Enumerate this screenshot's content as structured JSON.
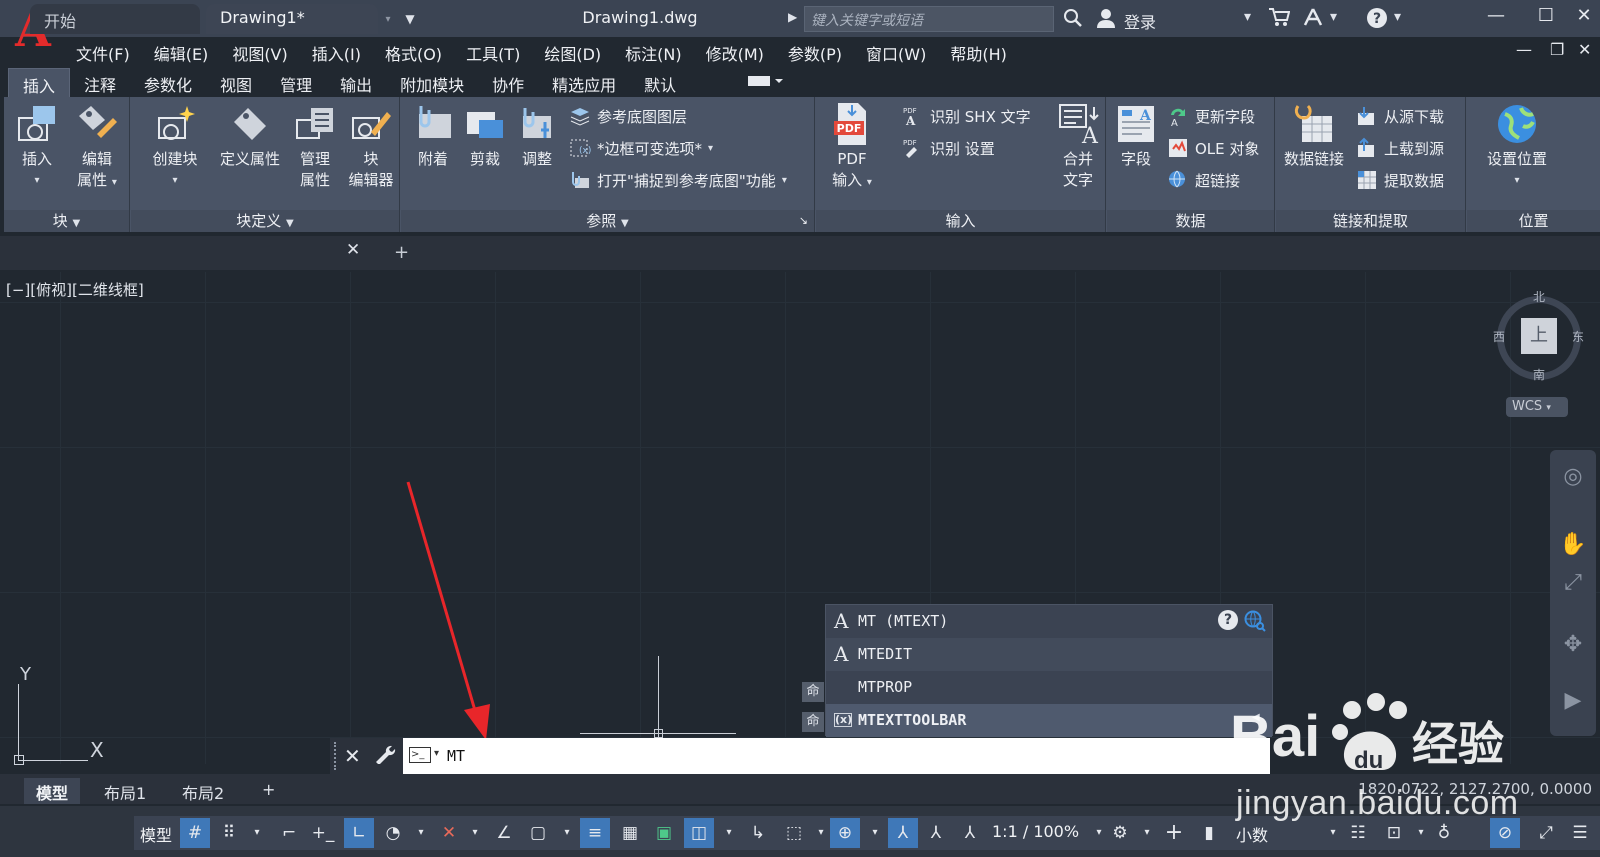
{
  "app": {
    "document_title": "Drawing1.dwg",
    "search_placeholder": "键入关键字或短语",
    "login_label": "登录"
  },
  "menu": [
    "文件(F)",
    "编辑(E)",
    "视图(V)",
    "插入(I)",
    "格式(O)",
    "工具(T)",
    "绘图(D)",
    "标注(N)",
    "修改(M)",
    "参数(P)",
    "窗口(W)",
    "帮助(H)"
  ],
  "ribbon_tabs": [
    "插入",
    "注释",
    "参数化",
    "视图",
    "管理",
    "输出",
    "附加模块",
    "协作",
    "精选应用",
    "默认"
  ],
  "ribbon": {
    "block": {
      "title": "块",
      "insert": "插入",
      "edit_attr_1": "编辑",
      "edit_attr_2": "属性"
    },
    "block_def": {
      "title": "块定义",
      "create": "创建块",
      "define_attr": "定义属性",
      "manage_attr_1": "管理",
      "manage_attr_2": "属性",
      "block_editor_1": "块",
      "block_editor_2": "编辑器"
    },
    "reference": {
      "title": "参照",
      "attach": "附着",
      "clip": "剪裁",
      "adjust": "调整",
      "underlay_layers": "参考底图图层",
      "frame_option": "*边框可变选项*",
      "snap_underlay": "打开\"捕捉到参考底图\"功能"
    },
    "import": {
      "title": "输入",
      "pdf_1": "PDF",
      "pdf_2": "输入",
      "recognize_shx": "识别 SHX 文字",
      "recognize_settings": "识别 设置",
      "combine_text_1": "合并",
      "combine_text_2": "文字"
    },
    "data": {
      "title": "数据",
      "field": "字段",
      "update_fields": "更新字段",
      "ole_object": "OLE 对象",
      "hyperlink": "超链接"
    },
    "link_extract": {
      "title": "链接和提取",
      "data_link": "数据链接",
      "download_source": "从源下载",
      "upload_source": "上载到源",
      "extract_data": "提取数据"
    },
    "location": {
      "title": "位置",
      "set_location": "设置位置"
    }
  },
  "file_tabs": {
    "start": "开始",
    "drawing": "Drawing1*"
  },
  "viewport_label": "[−][俯视][二维线框]",
  "viewcube": {
    "face": "上",
    "north": "北",
    "south": "南",
    "east": "东",
    "west": "西",
    "wcs": "WCS"
  },
  "ucs": {
    "x": "X",
    "y": "Y"
  },
  "autocomplete": {
    "items": [
      "MT (MTEXT)",
      "MTEDIT",
      "MTPROP",
      "MTEXTTOOLBAR"
    ],
    "history_prefix": "命"
  },
  "command_line": {
    "value": "MT"
  },
  "layout_tabs": [
    "模型",
    "布局1",
    "布局2"
  ],
  "coordinates": "1820.0722, 2127.2700, 0.0000",
  "status": {
    "model": "模型",
    "scale": "1:1 / 100%",
    "units": "小数"
  },
  "watermark": {
    "url": "jingyan.baidu.com"
  },
  "colors": {
    "accent": "#3f78b8",
    "logo_red": "#e32b2b",
    "annotation_red": "#e8262a"
  }
}
